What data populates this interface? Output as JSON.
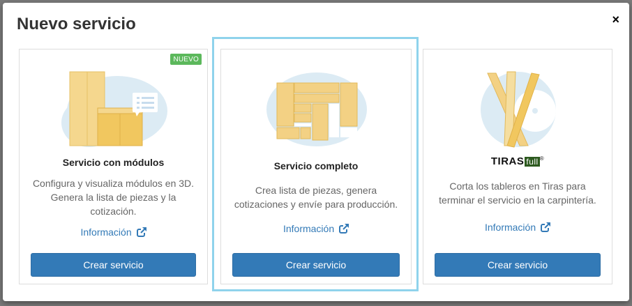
{
  "modal": {
    "title": "Nuevo servicio",
    "close_glyph": "×"
  },
  "cards": [
    {
      "badge": "NUEVO",
      "title": "Servicio con módulos",
      "description": "Configura y visualiza módulos en 3D. Genera la lista de piezas y la cotización.",
      "info_label": "Información",
      "button_label": "Crear servicio",
      "icon": "cabinet-modules-illustration"
    },
    {
      "title": "Servicio completo",
      "description": "Crea lista de piezas, genera cotizaciones y envíe para producción.",
      "info_label": "Información",
      "button_label": "Crear servicio",
      "icon": "cut-list-panels-illustration"
    },
    {
      "logo_text": "TIRAS",
      "logo_suffix": "full",
      "logo_mark": "®",
      "description": "Corta los tableros en Tiras para terminar el servicio en la carpintería.",
      "info_label": "Información",
      "button_label": "Crear servicio",
      "icon": "saw-strips-illustration"
    }
  ],
  "colors": {
    "primary": "#337ab7",
    "badge": "#5cb85c",
    "focus_ring": "#8fd3ec",
    "wood": "#f2d58a",
    "blob": "#dcebf4"
  }
}
